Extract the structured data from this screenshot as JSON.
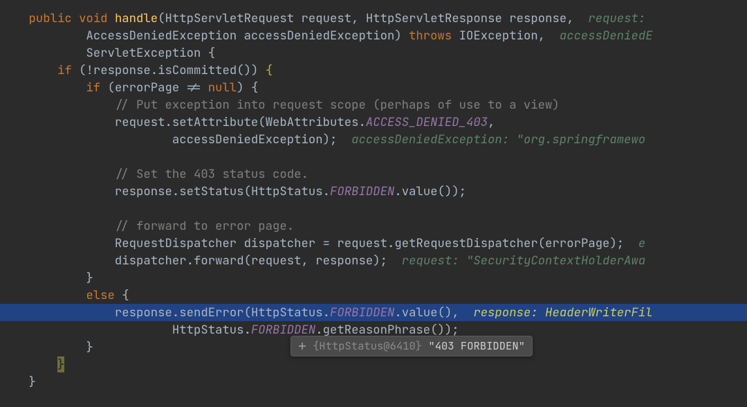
{
  "code": {
    "sig": {
      "public": "public",
      "void": "void",
      "handle": "handle",
      "param1_type": "HttpServletRequest",
      "param1_name": "request",
      "param2_type": "HttpServletResponse",
      "param2_name": "response",
      "hint1": "request:",
      "line2_type": "AccessDeniedException",
      "line2_name": "accessDeniedException",
      "throws": "throws",
      "exc1": "IOException",
      "hint2": "accessDeniedE",
      "line3_exc": "ServletException",
      "brace_open": "{"
    },
    "if1": {
      "if": "if",
      "not": "!",
      "obj": "response",
      "call": "isCommitted",
      "brace": "{"
    },
    "if2": {
      "if": "if",
      "var": "errorPage",
      "neq": "!=",
      "null": "null",
      "brace": "{"
    },
    "cm1": "// Put exception into request scope (perhaps of use to a view)",
    "setattr": {
      "obj": "request",
      "fn": "setAttribute",
      "cls": "WebAttributes",
      "const": "ACCESS_DENIED_403",
      "arg2": "accessDeniedException",
      "hint": "accessDeniedException: \"org.springframewo"
    },
    "cm2": "// Set the 403 status code.",
    "setstatus": {
      "obj": "response",
      "fn": "setStatus",
      "cls": "HttpStatus",
      "const": "FORBIDDEN",
      "val": "value"
    },
    "cm3": "// forward to error page.",
    "disp1": {
      "type": "RequestDispatcher",
      "var": "dispatcher",
      "obj": "request",
      "fn": "getRequestDispatcher",
      "arg": "errorPage",
      "hint": "e"
    },
    "disp2": {
      "obj": "dispatcher",
      "fn": "forward",
      "a1": "request",
      "a2": "response",
      "hint": "request: \"SecurityContextHolderAwa"
    },
    "brace_close_inner": "}",
    "else": {
      "kw": "else",
      "brace": "{"
    },
    "senderr": {
      "obj": "response",
      "fn": "sendError",
      "cls": "HttpStatus",
      "const": "FORBIDDEN",
      "val": "value",
      "hint": "response: HeaderWriterFil"
    },
    "senderr2": {
      "cls": "HttpStatus",
      "const": "FORBIDDEN",
      "fn": "getReasonPhrase"
    },
    "brace_close_else": "}",
    "brace_close_if1": "}",
    "brace_close_method": "}"
  },
  "tooltip": {
    "icon": "plus-icon",
    "prefix": "{HttpStatus@6410}",
    "value": "\"403 FORBIDDEN\""
  }
}
